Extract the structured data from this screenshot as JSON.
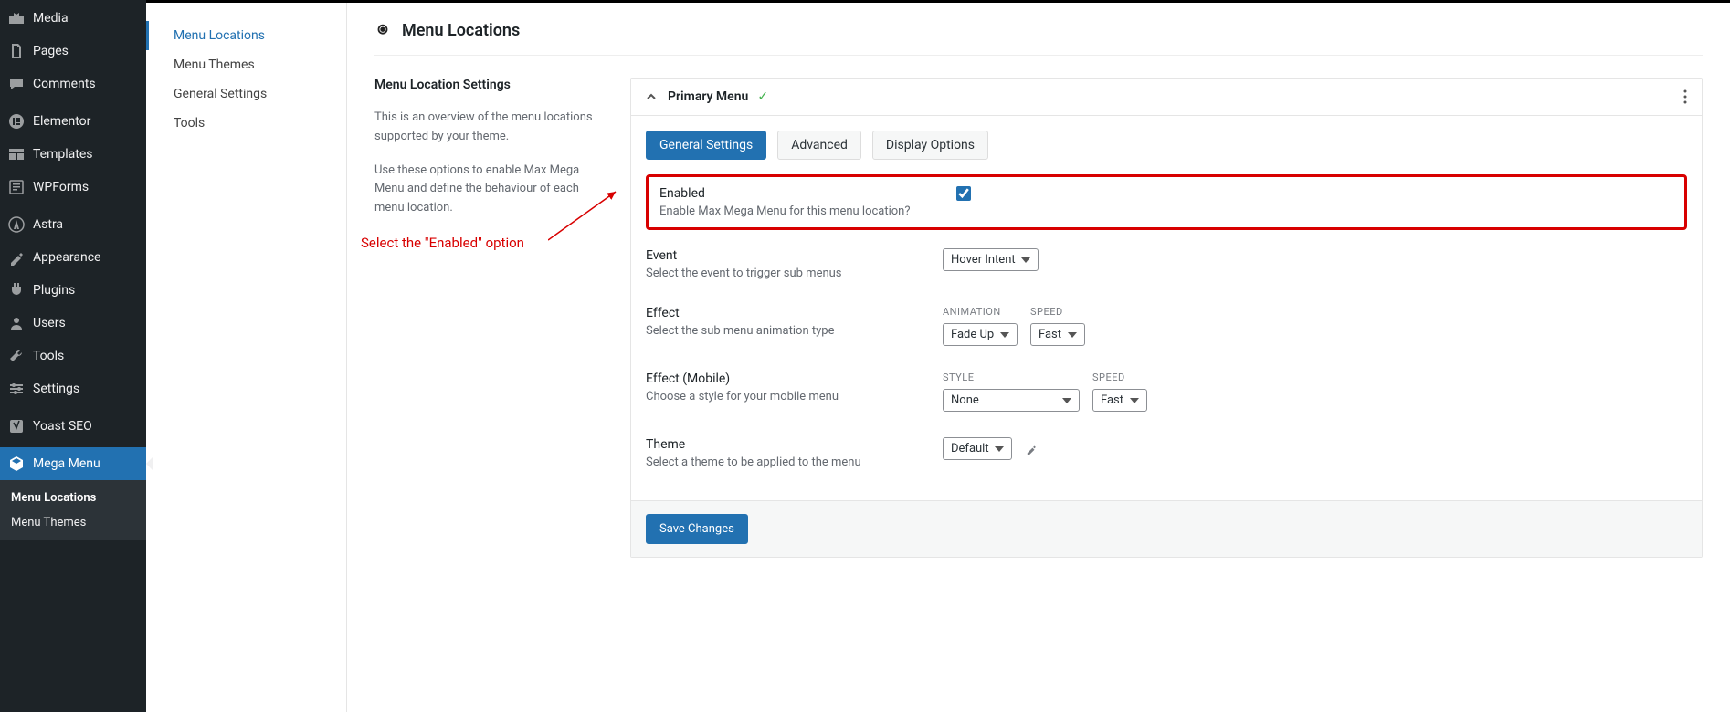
{
  "sidebar": {
    "items": [
      {
        "label": "Media",
        "icon": "media"
      },
      {
        "label": "Pages",
        "icon": "pages"
      },
      {
        "label": "Comments",
        "icon": "comments"
      },
      {
        "label": "Elementor",
        "icon": "elementor"
      },
      {
        "label": "Templates",
        "icon": "templates"
      },
      {
        "label": "WPForms",
        "icon": "wpforms"
      },
      {
        "label": "Astra",
        "icon": "astra"
      },
      {
        "label": "Appearance",
        "icon": "appearance"
      },
      {
        "label": "Plugins",
        "icon": "plugins"
      },
      {
        "label": "Users",
        "icon": "users"
      },
      {
        "label": "Tools",
        "icon": "tools"
      },
      {
        "label": "Settings",
        "icon": "settings"
      },
      {
        "label": "Yoast SEO",
        "icon": "yoast"
      },
      {
        "label": "Mega Menu",
        "icon": "megamenu"
      }
    ],
    "submenu": [
      {
        "label": "Menu Locations"
      },
      {
        "label": "Menu Themes"
      }
    ]
  },
  "subnav": {
    "items": [
      {
        "label": "Menu Locations"
      },
      {
        "label": "Menu Themes"
      },
      {
        "label": "General Settings"
      },
      {
        "label": "Tools"
      }
    ]
  },
  "page": {
    "title": "Menu Locations",
    "intro_title": "Menu Location Settings",
    "intro_p1": "This is an overview of the menu locations supported by your theme.",
    "intro_p2": "Use these options to enable Max Mega Menu and define the behaviour of each menu location."
  },
  "panel": {
    "title": "Primary Menu",
    "tabs": [
      "General Settings",
      "Advanced",
      "Display Options"
    ],
    "enabled": {
      "label": "Enabled",
      "desc": "Enable Max Mega Menu for this menu location?"
    },
    "event": {
      "label": "Event",
      "desc": "Select the event to trigger sub menus",
      "value": "Hover Intent"
    },
    "effect": {
      "label": "Effect",
      "desc": "Select the sub menu animation type",
      "anim_label": "ANIMATION",
      "anim_value": "Fade Up",
      "speed_label": "SPEED",
      "speed_value": "Fast"
    },
    "effect_mobile": {
      "label": "Effect (Mobile)",
      "desc": "Choose a style for your mobile menu",
      "style_label": "STYLE",
      "style_value": "None",
      "speed_label": "SPEED",
      "speed_value": "Fast"
    },
    "theme": {
      "label": "Theme",
      "desc": "Select a theme to be applied to the menu",
      "value": "Default"
    },
    "save_button": "Save Changes"
  },
  "annotation": "Select the \"Enabled\" option"
}
